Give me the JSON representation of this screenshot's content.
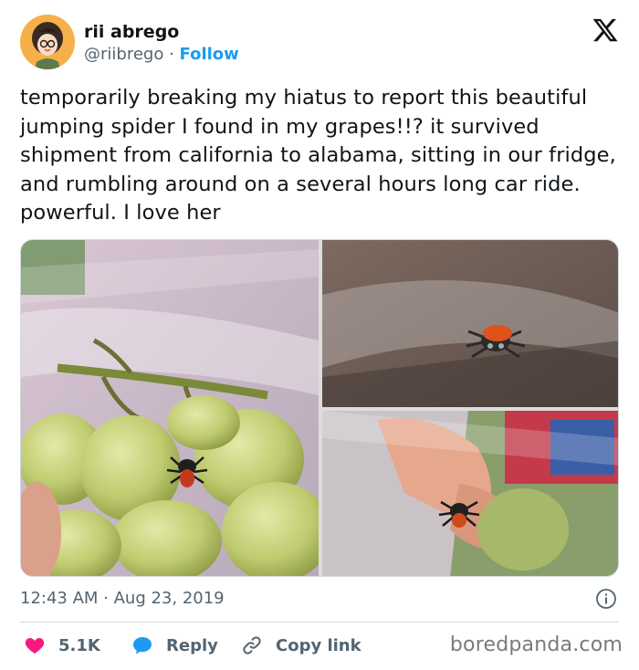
{
  "user": {
    "display_name": "rii abrego",
    "handle": "@riibrego",
    "separator": " · ",
    "follow_label": "Follow"
  },
  "tweet": {
    "text": "temporarily breaking my hiatus to report this beautiful jumping spider I found in my grapes!!? it survived shipment from california to alabama, sitting in our fridge, and rumbling around on a several hours long car ride. powerful. I love her",
    "timestamp": "12:43 AM · Aug 23, 2019"
  },
  "media": {
    "photos": [
      {
        "subject": "jumping spider on green grapes in plastic bag"
      },
      {
        "subject": "jumping spider on plastic bag close-up"
      },
      {
        "subject": "jumping spider on bag near fingers"
      }
    ]
  },
  "actions": {
    "like_count": "5.1K",
    "reply_label": "Reply",
    "copy_label": "Copy link"
  },
  "watermark": "boredpanda.com",
  "colors": {
    "accent": "#1d9bf0",
    "like": "#f91880",
    "text": "#0f1419",
    "muted": "#536471",
    "border": "#cfd9de"
  },
  "icons": [
    "x-logo-icon",
    "info-icon",
    "heart-icon",
    "reply-bubble-icon",
    "link-icon"
  ]
}
